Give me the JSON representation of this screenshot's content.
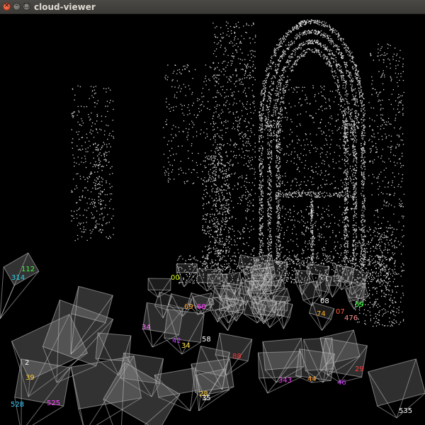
{
  "window": {
    "title": "cloud-viewer"
  },
  "camera_labels": [
    {
      "text": "314",
      "color": "#2ad3e8"
    },
    {
      "text": "112",
      "color": "#3cff3c"
    },
    {
      "text": "00",
      "color": "#d9ff22"
    },
    {
      "text": "69",
      "color": "#ffa020"
    },
    {
      "text": "68",
      "color": "#ff3cff"
    },
    {
      "text": "34",
      "color": "#ff78ff"
    },
    {
      "text": "42",
      "color": "#c040ff"
    },
    {
      "text": "34",
      "color": "#ffe040"
    },
    {
      "text": "58",
      "color": "#ffffff"
    },
    {
      "text": "88",
      "color": "#ff3030"
    },
    {
      "text": "08",
      "color": "#ffffff"
    },
    {
      "text": "74",
      "color": "#ffb020"
    },
    {
      "text": "07",
      "color": "#ff6040"
    },
    {
      "text": "476",
      "color": "#ff9090"
    },
    {
      "text": "59",
      "color": "#30ff30"
    },
    {
      "text": "2",
      "color": "#ffffff"
    },
    {
      "text": "39",
      "color": "#ffcc33"
    },
    {
      "text": "528",
      "color": "#38d0ff"
    },
    {
      "text": "525",
      "color": "#ff40ff"
    },
    {
      "text": "343",
      "color": "#ff44ff"
    },
    {
      "text": "44",
      "color": "#ffa030"
    },
    {
      "text": "46",
      "color": "#d040ff"
    },
    {
      "text": "29",
      "color": "#ff4040"
    },
    {
      "text": "28",
      "color": "#ffcc33"
    },
    {
      "text": "35",
      "color": "#ffffff"
    },
    {
      "text": "535",
      "color": "#ffffff"
    }
  ]
}
